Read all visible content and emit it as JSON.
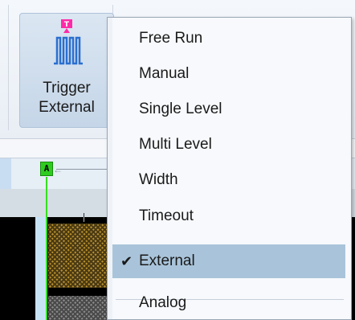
{
  "ribbon": {
    "trigger_button": {
      "label_line1": "Trigger",
      "label_line2": "External",
      "icon": "trigger-waveform-icon"
    }
  },
  "marker": {
    "label": "A",
    "color": "#2ecc1f"
  },
  "trigger_menu": {
    "items": [
      {
        "label": "Free Run",
        "checked": false
      },
      {
        "label": "Manual",
        "checked": false
      },
      {
        "label": "Single Level",
        "checked": false
      },
      {
        "label": "Multi Level",
        "checked": false
      },
      {
        "label": "Width",
        "checked": false
      },
      {
        "label": "Timeout",
        "checked": false
      },
      {
        "label": "External",
        "checked": true
      },
      {
        "label": "Analog",
        "checked": false
      }
    ],
    "check_glyph": "✔",
    "selected_color": "#a9c4da"
  }
}
